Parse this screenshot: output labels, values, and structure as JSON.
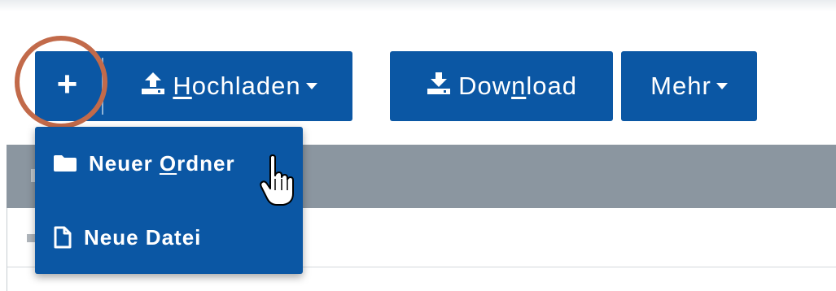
{
  "toolbar": {
    "new_label": "+",
    "upload": {
      "prefix": "",
      "accel": "H",
      "rest": "ochladen"
    },
    "download": {
      "prefix": "Dow",
      "accel": "n",
      "rest": "load"
    },
    "more_label": "Mehr"
  },
  "new_menu": {
    "items": [
      {
        "prefix": "Neuer ",
        "accel": "O",
        "rest": "rdner",
        "icon": "folder-icon"
      },
      {
        "prefix": "Neue Datei",
        "accel": "",
        "rest": "",
        "icon": "file-icon"
      }
    ]
  },
  "colors": {
    "button_bg": "#0b57a4",
    "highlight_ring": "#c26a4a",
    "header_bar": "#8b96a0"
  }
}
